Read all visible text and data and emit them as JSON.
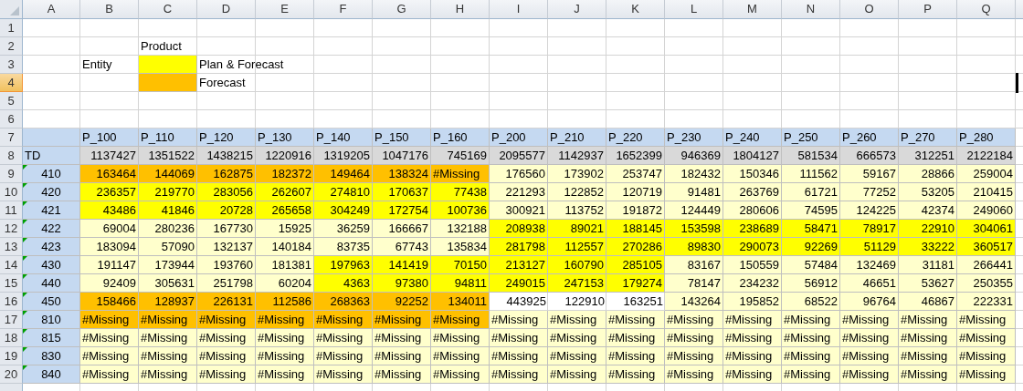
{
  "columns": [
    "A",
    "B",
    "C",
    "D",
    "E",
    "F",
    "G",
    "H",
    "I",
    "J",
    "K",
    "L",
    "M",
    "N",
    "O",
    "P",
    "Q"
  ],
  "rows": [
    {
      "number": "1",
      "selected": false,
      "cells": []
    },
    {
      "number": "2",
      "selected": false,
      "cells": [
        {},
        {},
        {
          "text": "Product"
        }
      ]
    },
    {
      "number": "3",
      "selected": false,
      "cells": [
        {},
        {
          "text": "Entity"
        },
        {
          "color": "#ffff00"
        },
        {
          "text": "Plan & Forecast"
        }
      ]
    },
    {
      "number": "4",
      "selected": true,
      "cells": [
        {},
        {},
        {
          "color": "#ffc000"
        },
        {
          "text": "Forecast"
        }
      ]
    },
    {
      "number": "5",
      "selected": false,
      "cells": []
    },
    {
      "number": "6",
      "selected": false,
      "cells": []
    },
    {
      "number": "7",
      "selected": false,
      "cells": [
        {
          "color": "#c5d9f1"
        },
        {
          "text": "P_100",
          "color": "#c5d9f1"
        },
        {
          "text": "P_110",
          "color": "#c5d9f1"
        },
        {
          "text": "P_120",
          "color": "#c5d9f1"
        },
        {
          "text": "P_130",
          "color": "#c5d9f1"
        },
        {
          "text": "P_140",
          "color": "#c5d9f1"
        },
        {
          "text": "P_150",
          "color": "#c5d9f1"
        },
        {
          "text": "P_160",
          "color": "#c5d9f1"
        },
        {
          "text": "P_200",
          "color": "#c5d9f1"
        },
        {
          "text": "P_210",
          "color": "#c5d9f1"
        },
        {
          "text": "P_220",
          "color": "#c5d9f1"
        },
        {
          "text": "P_230",
          "color": "#c5d9f1"
        },
        {
          "text": "P_240",
          "color": "#c5d9f1"
        },
        {
          "text": "P_250",
          "color": "#c5d9f1"
        },
        {
          "text": "P_260",
          "color": "#c5d9f1"
        },
        {
          "text": "P_270",
          "color": "#c5d9f1"
        },
        {
          "text": "P_280",
          "color": "#c5d9f1"
        }
      ]
    },
    {
      "number": "8",
      "selected": false,
      "cells": [
        {
          "text": "TD",
          "color": "#c5d9f1"
        },
        {
          "text": "1137427",
          "color": "#d9d9d9"
        },
        {
          "text": "1351522",
          "color": "#d9d9d9"
        },
        {
          "text": "1438215",
          "color": "#d9d9d9"
        },
        {
          "text": "1220916",
          "color": "#d9d9d9"
        },
        {
          "text": "1319205",
          "color": "#d9d9d9"
        },
        {
          "text": "1047176",
          "color": "#d9d9d9"
        },
        {
          "text": "745169",
          "color": "#d9d9d9"
        },
        {
          "text": "2095577",
          "color": "#d9d9d9"
        },
        {
          "text": "1142937",
          "color": "#d9d9d9"
        },
        {
          "text": "1652399",
          "color": "#d9d9d9"
        },
        {
          "text": "946369",
          "color": "#d9d9d9"
        },
        {
          "text": "1804127",
          "color": "#d9d9d9"
        },
        {
          "text": "581534",
          "color": "#d9d9d9"
        },
        {
          "text": "666573",
          "color": "#d9d9d9"
        },
        {
          "text": "312251",
          "color": "#d9d9d9"
        },
        {
          "text": "2122184",
          "color": "#d9d9d9"
        }
      ]
    },
    {
      "number": "9",
      "selected": false,
      "cells": [
        {
          "text": "410",
          "color": "#c5d9f1",
          "flag": true
        },
        {
          "text": "163464",
          "color": "#ffc000"
        },
        {
          "text": "144069",
          "color": "#ffc000"
        },
        {
          "text": "162875",
          "color": "#ffc000"
        },
        {
          "text": "182372",
          "color": "#ffc000"
        },
        {
          "text": "149464",
          "color": "#ffc000"
        },
        {
          "text": "138324",
          "color": "#ffc000"
        },
        {
          "text": "#Missing",
          "color": "#ffc000"
        },
        {
          "text": "176560",
          "color": "#ffffcc"
        },
        {
          "text": "173902",
          "color": "#ffffcc"
        },
        {
          "text": "253747",
          "color": "#ffffcc"
        },
        {
          "text": "182432",
          "color": "#ffffcc"
        },
        {
          "text": "150346",
          "color": "#ffffcc"
        },
        {
          "text": "111562",
          "color": "#ffffcc"
        },
        {
          "text": "59167",
          "color": "#ffffcc"
        },
        {
          "text": "28866",
          "color": "#ffffcc"
        },
        {
          "text": "259004",
          "color": "#ffffcc"
        }
      ]
    },
    {
      "number": "10",
      "selected": false,
      "cells": [
        {
          "text": "420",
          "color": "#c5d9f1",
          "flag": true
        },
        {
          "text": "236357",
          "color": "#ffff00"
        },
        {
          "text": "219770",
          "color": "#ffff00"
        },
        {
          "text": "283056",
          "color": "#ffff00"
        },
        {
          "text": "262607",
          "color": "#ffff00"
        },
        {
          "text": "274810",
          "color": "#ffff00"
        },
        {
          "text": "170637",
          "color": "#ffff00"
        },
        {
          "text": "77438",
          "color": "#ffff00"
        },
        {
          "text": "221293",
          "color": "#ffffcc"
        },
        {
          "text": "122852",
          "color": "#ffffcc"
        },
        {
          "text": "120719",
          "color": "#ffffcc"
        },
        {
          "text": "91481",
          "color": "#ffffcc"
        },
        {
          "text": "263769",
          "color": "#ffffcc"
        },
        {
          "text": "61721",
          "color": "#ffffcc"
        },
        {
          "text": "77252",
          "color": "#ffffcc"
        },
        {
          "text": "53205",
          "color": "#ffffcc"
        },
        {
          "text": "210415",
          "color": "#ffffcc"
        }
      ]
    },
    {
      "number": "11",
      "selected": false,
      "cells": [
        {
          "text": "421",
          "color": "#c5d9f1",
          "flag": true
        },
        {
          "text": "43486",
          "color": "#ffff00"
        },
        {
          "text": "41846",
          "color": "#ffff00"
        },
        {
          "text": "20728",
          "color": "#ffff00"
        },
        {
          "text": "265658",
          "color": "#ffff00"
        },
        {
          "text": "304249",
          "color": "#ffff00"
        },
        {
          "text": "172754",
          "color": "#ffff00"
        },
        {
          "text": "100736",
          "color": "#ffff00"
        },
        {
          "text": "300921",
          "color": "#ffffcc"
        },
        {
          "text": "113752",
          "color": "#ffffcc"
        },
        {
          "text": "191872",
          "color": "#ffffcc"
        },
        {
          "text": "124449",
          "color": "#ffffcc"
        },
        {
          "text": "280606",
          "color": "#ffffcc"
        },
        {
          "text": "74595",
          "color": "#ffffcc"
        },
        {
          "text": "124225",
          "color": "#ffffcc"
        },
        {
          "text": "42374",
          "color": "#ffffcc"
        },
        {
          "text": "249060",
          "color": "#ffffcc"
        }
      ]
    },
    {
      "number": "12",
      "selected": false,
      "cells": [
        {
          "text": "422",
          "color": "#c5d9f1",
          "flag": true
        },
        {
          "text": "69004",
          "color": "#ffffcc"
        },
        {
          "text": "280236",
          "color": "#ffffcc"
        },
        {
          "text": "167730",
          "color": "#ffffcc"
        },
        {
          "text": "15925",
          "color": "#ffffcc"
        },
        {
          "text": "36259",
          "color": "#ffffcc"
        },
        {
          "text": "166667",
          "color": "#ffffcc"
        },
        {
          "text": "132188",
          "color": "#ffffcc"
        },
        {
          "text": "208938",
          "color": "#ffff00"
        },
        {
          "text": "89021",
          "color": "#ffff00"
        },
        {
          "text": "188145",
          "color": "#ffff00"
        },
        {
          "text": "153598",
          "color": "#ffff00"
        },
        {
          "text": "238689",
          "color": "#ffff00"
        },
        {
          "text": "58471",
          "color": "#ffff00"
        },
        {
          "text": "78917",
          "color": "#ffff00"
        },
        {
          "text": "22910",
          "color": "#ffff00"
        },
        {
          "text": "304061",
          "color": "#ffff00"
        }
      ]
    },
    {
      "number": "13",
      "selected": false,
      "cells": [
        {
          "text": "423",
          "color": "#c5d9f1",
          "flag": true
        },
        {
          "text": "183094",
          "color": "#ffffcc"
        },
        {
          "text": "57090",
          "color": "#ffffcc"
        },
        {
          "text": "132137",
          "color": "#ffffcc"
        },
        {
          "text": "140184",
          "color": "#ffffcc"
        },
        {
          "text": "83735",
          "color": "#ffffcc"
        },
        {
          "text": "67743",
          "color": "#ffffcc"
        },
        {
          "text": "135834",
          "color": "#ffffcc"
        },
        {
          "text": "281798",
          "color": "#ffff00"
        },
        {
          "text": "112557",
          "color": "#ffff00"
        },
        {
          "text": "270286",
          "color": "#ffff00"
        },
        {
          "text": "89830",
          "color": "#ffff00"
        },
        {
          "text": "290073",
          "color": "#ffff00"
        },
        {
          "text": "92269",
          "color": "#ffff00"
        },
        {
          "text": "51129",
          "color": "#ffff00"
        },
        {
          "text": "33222",
          "color": "#ffff00"
        },
        {
          "text": "360517",
          "color": "#ffff00"
        }
      ]
    },
    {
      "number": "14",
      "selected": false,
      "cells": [
        {
          "text": "430",
          "color": "#c5d9f1",
          "flag": true
        },
        {
          "text": "191147",
          "color": "#ffffcc"
        },
        {
          "text": "173944",
          "color": "#ffffcc"
        },
        {
          "text": "193760",
          "color": "#ffffcc"
        },
        {
          "text": "181381",
          "color": "#ffffcc"
        },
        {
          "text": "197963",
          "color": "#ffff00"
        },
        {
          "text": "141419",
          "color": "#ffff00"
        },
        {
          "text": "70150",
          "color": "#ffff00"
        },
        {
          "text": "213127",
          "color": "#ffff00"
        },
        {
          "text": "160790",
          "color": "#ffff00"
        },
        {
          "text": "285105",
          "color": "#ffff00"
        },
        {
          "text": "83167",
          "color": "#ffffcc"
        },
        {
          "text": "150559",
          "color": "#ffffcc"
        },
        {
          "text": "57484",
          "color": "#ffffcc"
        },
        {
          "text": "132469",
          "color": "#ffffcc"
        },
        {
          "text": "31181",
          "color": "#ffffcc"
        },
        {
          "text": "266441",
          "color": "#ffffcc"
        }
      ]
    },
    {
      "number": "15",
      "selected": false,
      "cells": [
        {
          "text": "440",
          "color": "#c5d9f1",
          "flag": true
        },
        {
          "text": "92409",
          "color": "#ffffcc"
        },
        {
          "text": "305631",
          "color": "#ffffcc"
        },
        {
          "text": "251798",
          "color": "#ffffcc"
        },
        {
          "text": "60204",
          "color": "#ffffcc"
        },
        {
          "text": "4363",
          "color": "#ffff00"
        },
        {
          "text": "97380",
          "color": "#ffff00"
        },
        {
          "text": "94811",
          "color": "#ffff00"
        },
        {
          "text": "249015",
          "color": "#ffff00"
        },
        {
          "text": "247153",
          "color": "#ffff00"
        },
        {
          "text": "179274",
          "color": "#ffff00"
        },
        {
          "text": "78147",
          "color": "#ffffcc"
        },
        {
          "text": "234232",
          "color": "#ffffcc"
        },
        {
          "text": "56912",
          "color": "#ffffcc"
        },
        {
          "text": "46651",
          "color": "#ffffcc"
        },
        {
          "text": "53627",
          "color": "#ffffcc"
        },
        {
          "text": "250355",
          "color": "#ffffcc"
        }
      ]
    },
    {
      "number": "16",
      "selected": false,
      "cells": [
        {
          "text": "450",
          "color": "#c5d9f1",
          "flag": true
        },
        {
          "text": "158466",
          "color": "#ffc000"
        },
        {
          "text": "128937",
          "color": "#ffc000"
        },
        {
          "text": "226131",
          "color": "#ffc000"
        },
        {
          "text": "112586",
          "color": "#ffc000"
        },
        {
          "text": "268363",
          "color": "#ffc000"
        },
        {
          "text": "92252",
          "color": "#ffc000"
        },
        {
          "text": "134011",
          "color": "#ffc000"
        },
        {
          "text": "443925"
        },
        {
          "text": "122910"
        },
        {
          "text": "163251"
        },
        {
          "text": "143264",
          "color": "#ffffcc"
        },
        {
          "text": "195852",
          "color": "#ffffcc"
        },
        {
          "text": "68522",
          "color": "#ffffcc"
        },
        {
          "text": "96764",
          "color": "#ffffcc"
        },
        {
          "text": "46867",
          "color": "#ffffcc"
        },
        {
          "text": "222331",
          "color": "#ffffcc"
        }
      ]
    },
    {
      "number": "17",
      "selected": false,
      "cells": [
        {
          "text": "810",
          "color": "#c5d9f1",
          "flag": true
        },
        {
          "text": "#Missing",
          "color": "#ffc000"
        },
        {
          "text": "#Missing",
          "color": "#ffc000"
        },
        {
          "text": "#Missing",
          "color": "#ffc000"
        },
        {
          "text": "#Missing",
          "color": "#ffc000"
        },
        {
          "text": "#Missing",
          "color": "#ffc000"
        },
        {
          "text": "#Missing",
          "color": "#ffc000"
        },
        {
          "text": "#Missing",
          "color": "#ffc000"
        },
        {
          "text": "#Missing",
          "color": "#ffffcc"
        },
        {
          "text": "#Missing",
          "color": "#ffffcc"
        },
        {
          "text": "#Missing",
          "color": "#ffffcc"
        },
        {
          "text": "#Missing",
          "color": "#ffffcc"
        },
        {
          "text": "#Missing",
          "color": "#ffffcc"
        },
        {
          "text": "#Missing",
          "color": "#ffffcc"
        },
        {
          "text": "#Missing",
          "color": "#ffffcc"
        },
        {
          "text": "#Missing",
          "color": "#ffffcc"
        },
        {
          "text": "#Missing",
          "color": "#ffffcc"
        }
      ]
    },
    {
      "number": "18",
      "selected": false,
      "cells": [
        {
          "text": "815",
          "color": "#c5d9f1",
          "flag": true
        },
        {
          "text": "#Missing",
          "color": "#ffffcc"
        },
        {
          "text": "#Missing",
          "color": "#ffffcc"
        },
        {
          "text": "#Missing",
          "color": "#ffffcc"
        },
        {
          "text": "#Missing",
          "color": "#ffffcc"
        },
        {
          "text": "#Missing",
          "color": "#ffffcc"
        },
        {
          "text": "#Missing",
          "color": "#ffffcc"
        },
        {
          "text": "#Missing",
          "color": "#ffffcc"
        },
        {
          "text": "#Missing",
          "color": "#ffffcc"
        },
        {
          "text": "#Missing",
          "color": "#ffffcc"
        },
        {
          "text": "#Missing",
          "color": "#ffffcc"
        },
        {
          "text": "#Missing",
          "color": "#ffffcc"
        },
        {
          "text": "#Missing",
          "color": "#ffffcc"
        },
        {
          "text": "#Missing",
          "color": "#ffffcc"
        },
        {
          "text": "#Missing",
          "color": "#ffffcc"
        },
        {
          "text": "#Missing",
          "color": "#ffffcc"
        },
        {
          "text": "#Missing",
          "color": "#ffffcc"
        }
      ]
    },
    {
      "number": "19",
      "selected": false,
      "cells": [
        {
          "text": "830",
          "color": "#c5d9f1",
          "flag": true
        },
        {
          "text": "#Missing",
          "color": "#ffffcc"
        },
        {
          "text": "#Missing",
          "color": "#ffffcc"
        },
        {
          "text": "#Missing",
          "color": "#ffffcc"
        },
        {
          "text": "#Missing",
          "color": "#ffffcc"
        },
        {
          "text": "#Missing",
          "color": "#ffffcc"
        },
        {
          "text": "#Missing",
          "color": "#ffffcc"
        },
        {
          "text": "#Missing",
          "color": "#ffffcc"
        },
        {
          "text": "#Missing",
          "color": "#ffffcc"
        },
        {
          "text": "#Missing",
          "color": "#ffffcc"
        },
        {
          "text": "#Missing",
          "color": "#ffffcc"
        },
        {
          "text": "#Missing",
          "color": "#ffffcc"
        },
        {
          "text": "#Missing",
          "color": "#ffffcc"
        },
        {
          "text": "#Missing",
          "color": "#ffffcc"
        },
        {
          "text": "#Missing",
          "color": "#ffffcc"
        },
        {
          "text": "#Missing",
          "color": "#ffffcc"
        },
        {
          "text": "#Missing",
          "color": "#ffffcc"
        }
      ]
    },
    {
      "number": "20",
      "selected": false,
      "cells": [
        {
          "text": "840",
          "color": "#c5d9f1",
          "flag": true
        },
        {
          "text": "#Missing",
          "color": "#ffffcc"
        },
        {
          "text": "#Missing",
          "color": "#ffffcc"
        },
        {
          "text": "#Missing",
          "color": "#ffffcc"
        },
        {
          "text": "#Missing",
          "color": "#ffffcc"
        },
        {
          "text": "#Missing",
          "color": "#ffffcc"
        },
        {
          "text": "#Missing",
          "color": "#ffffcc"
        },
        {
          "text": "#Missing",
          "color": "#ffffcc"
        },
        {
          "text": "#Missing",
          "color": "#ffffcc"
        },
        {
          "text": "#Missing",
          "color": "#ffffcc"
        },
        {
          "text": "#Missing",
          "color": "#ffffcc"
        },
        {
          "text": "#Missing",
          "color": "#ffffcc"
        },
        {
          "text": "#Missing",
          "color": "#ffffcc"
        },
        {
          "text": "#Missing",
          "color": "#ffffcc"
        },
        {
          "text": "#Missing",
          "color": "#ffffcc"
        },
        {
          "text": "#Missing",
          "color": "#ffffcc"
        },
        {
          "text": "#Missing",
          "color": "#ffffcc"
        }
      ]
    }
  ]
}
